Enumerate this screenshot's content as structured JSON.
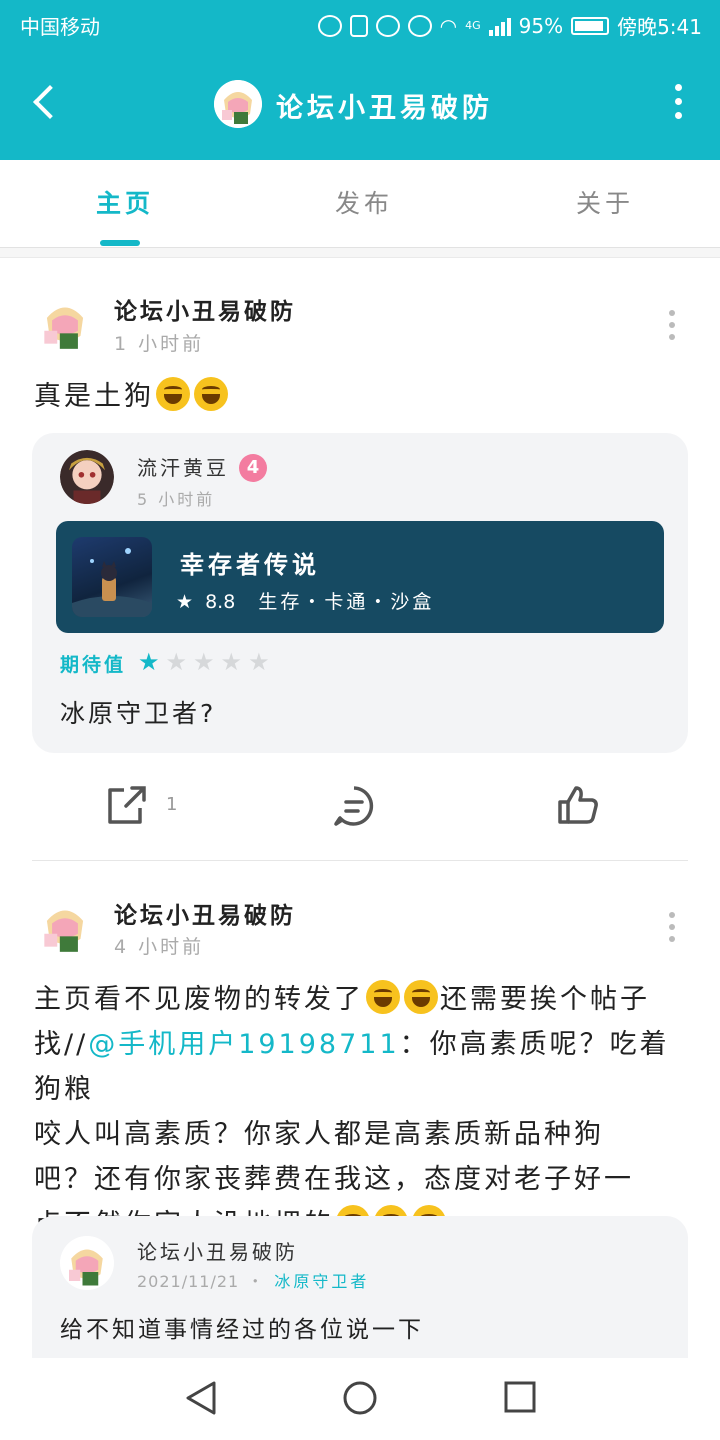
{
  "status_bar": {
    "carrier": "中国移动",
    "network": "4G",
    "battery": "95%",
    "time": "傍晚5:41"
  },
  "header": {
    "title": "论坛小丑易破防"
  },
  "tabs": [
    {
      "label": "主页"
    },
    {
      "label": "发布"
    },
    {
      "label": "关于"
    }
  ],
  "posts": [
    {
      "author": "论坛小丑易破防",
      "time": "1 小时前",
      "text": "真是土狗",
      "quote": {
        "author": "流汗黄豆",
        "level": "4",
        "time": "5 小时前",
        "game": {
          "title": "幸存者传说",
          "score": "8.8",
          "tags": "生存・卡通・沙盒"
        },
        "rating_label": "期待值",
        "rating": 1,
        "rating_max": 5,
        "text": "冰原守卫者?"
      },
      "share_count": "1"
    },
    {
      "author": "论坛小丑易破防",
      "time": "4 小时前",
      "text_line1a": "主页看不见废物的转发了",
      "text_line1b": "还需要挨个帖子",
      "text_line2a": "找//",
      "mention": "@手机用户19198711",
      "text_line2b": "：你高素质呢？吃着狗粮",
      "text_line3": "咬人叫高素质？你家人都是高素质新品种狗",
      "text_line4": "吧？还有你家丧葬费在我这，态度对老子好一",
      "text_line5": "点不然你家人没地埋的",
      "quote": {
        "author": "论坛小丑易破防",
        "date": "2021/11/21",
        "tag": "冰原守卫者",
        "text": "给不知道事情经过的各位说一下"
      }
    }
  ],
  "colors": {
    "accent": "#14b8c8",
    "game_card": "#164a62",
    "badge": "#f37ca0"
  }
}
